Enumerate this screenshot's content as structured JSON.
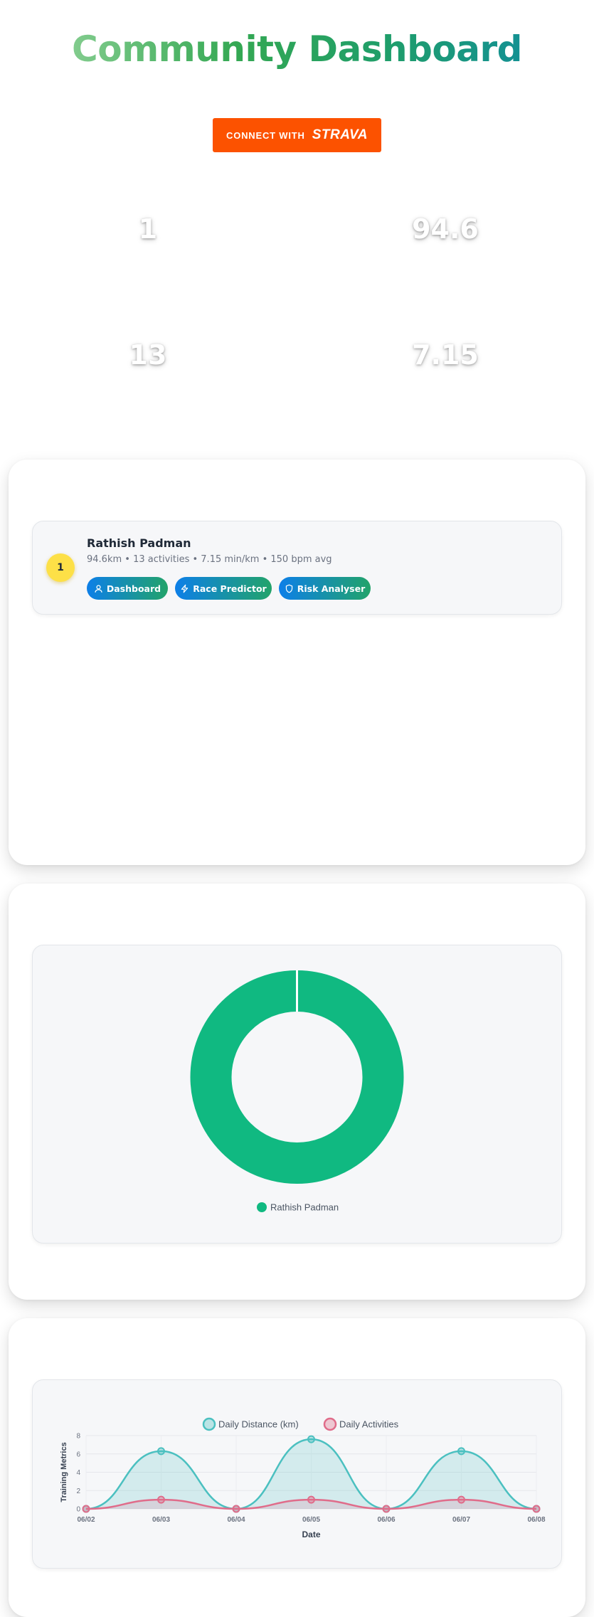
{
  "header": {
    "title": "Community Dashboard"
  },
  "strava_button": {
    "connect_label": "CONNECT WITH",
    "brand": "STRAVA"
  },
  "stats": {
    "athletes": "1",
    "total_distance": "94.6",
    "activities": "13",
    "avg_pace": "7.15"
  },
  "leaderboard": {
    "entries": [
      {
        "rank": "1",
        "name": "Rathish Padman",
        "summary": "94.6km • 13 activities • 7.15 min/km • 150 bpm avg",
        "buttons": [
          "Dashboard",
          "Race Predictor",
          "Risk Analyser"
        ]
      }
    ]
  },
  "colors": {
    "accent_green": "#10b981",
    "strava_orange": "#fc5200",
    "teal": "#4bc0c0",
    "pink": "#e06c8a",
    "rank_gold": "#fde047"
  },
  "distance_chart": {
    "chart_data": {
      "type": "pie",
      "variant": "doughnut",
      "labels": [
        "Rathish Padman"
      ],
      "values": [
        94.6
      ],
      "legend": "bottom"
    }
  },
  "training_chart": {
    "chart_data": {
      "type": "area",
      "x": [
        "06/02",
        "06/03",
        "06/04",
        "06/05",
        "06/06",
        "06/07",
        "06/08"
      ],
      "series": [
        {
          "name": "Daily Distance (km)",
          "values": [
            0,
            6.3,
            0,
            7.6,
            0,
            6.3,
            0
          ]
        },
        {
          "name": "Daily Activities",
          "values": [
            0,
            1,
            0,
            1,
            0,
            1,
            0
          ]
        }
      ],
      "xlabel": "Date",
      "ylabel": "Training Metrics",
      "yticks": [
        "0",
        "2",
        "4",
        "6",
        "8"
      ],
      "ylim": [
        0,
        8
      ],
      "legend": "top",
      "grid": true
    }
  }
}
